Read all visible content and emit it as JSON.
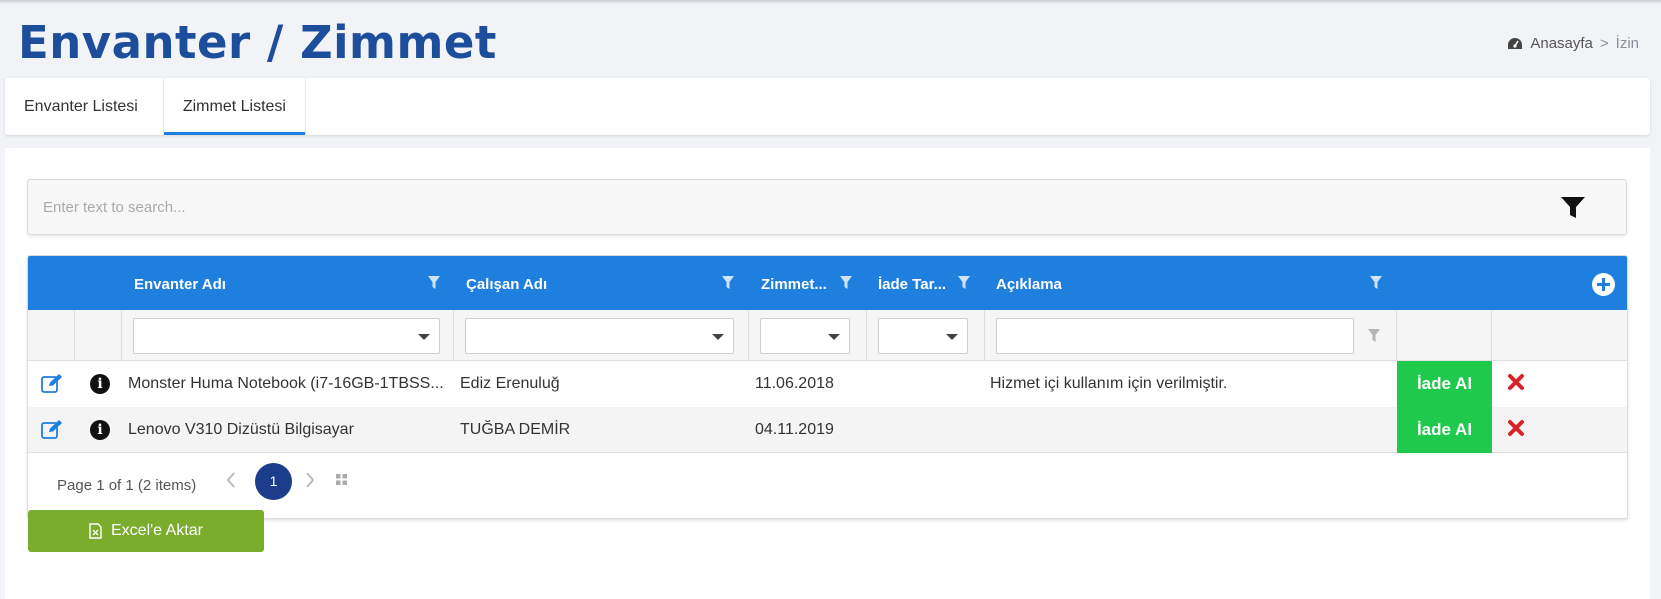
{
  "page": {
    "title": "Envanter / Zimmet",
    "breadcrumb": {
      "home": "Anasayfa",
      "separator": ">",
      "current": "İzin"
    }
  },
  "tabs": [
    {
      "label": "Envanter Listesi",
      "active": false
    },
    {
      "label": "Zimmet Listesi",
      "active": true
    }
  ],
  "search": {
    "placeholder": "Enter text to search...",
    "value": ""
  },
  "grid": {
    "columns": [
      "Envanter Adı",
      "Çalışan Adı",
      "Zimmet...",
      "İade Tar...",
      "Açıklama"
    ],
    "rows": [
      {
        "envanter": "Monster Huma Notebook (i7-16GB-1TBSS...",
        "calisan": "Ediz Erenuluğ",
        "zimmet": "11.06.2018",
        "iade": "",
        "aciklama": "Hizmet içi kullanım için verilmiştir.",
        "action": "İade Al"
      },
      {
        "envanter": "Lenovo V310 Dizüstü Bilgisayar",
        "calisan": "TUĞBA DEMİR",
        "zimmet": "04.11.2019",
        "iade": "",
        "aciklama": "",
        "action": "İade Al"
      }
    ],
    "pager": {
      "summary": "Page 1 of 1 (2 items)",
      "current_page": "1"
    }
  },
  "export": {
    "label": "Excel'e Aktar"
  },
  "colors": {
    "header_blue": "#1e7fde",
    "title_blue": "#1d4e9b",
    "iade_green": "#1ec94c",
    "excel_green": "#7aad2c",
    "page_active": "#1c3c8c",
    "delete_red": "#d9232a"
  },
  "icons": [
    "dashboard-icon",
    "filter-icon",
    "add-icon",
    "edit-icon",
    "info-icon",
    "delete-icon",
    "prev-page-icon",
    "next-page-icon",
    "page-size-icon",
    "excel-icon"
  ]
}
